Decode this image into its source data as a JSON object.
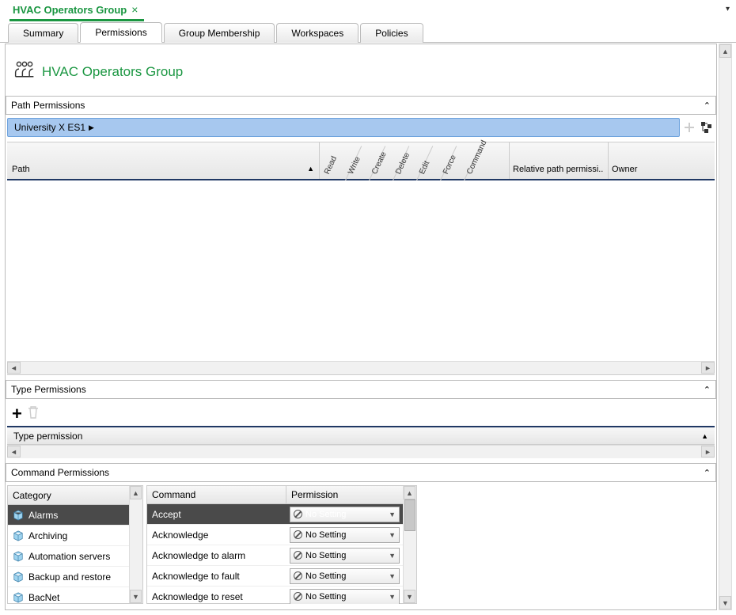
{
  "doc_tab": {
    "title": "HVAC Operators Group"
  },
  "sub_tabs": [
    "Summary",
    "Permissions",
    "Group Membership",
    "Workspaces",
    "Policies"
  ],
  "active_sub_tab": 1,
  "page_title": "HVAC Operators Group",
  "sections": {
    "path": {
      "label": "Path Permissions"
    },
    "type": {
      "label": "Type Permissions"
    },
    "command": {
      "label": "Command Permissions"
    }
  },
  "path_chip": "University X ES1",
  "path_columns": {
    "path": "Path",
    "diagonal": [
      "Read",
      "Write",
      "Create",
      "Delete",
      "Edit",
      "Force",
      "Command"
    ],
    "relative": "Relative path permissi..",
    "owner": "Owner"
  },
  "type_column": "Type permission",
  "categories": {
    "header": "Category",
    "items": [
      "Alarms",
      "Archiving",
      "Automation servers",
      "Backup and restore",
      "BacNet"
    ],
    "selected": 0
  },
  "commands": {
    "headers": {
      "command": "Command",
      "permission": "Permission"
    },
    "rows": [
      {
        "name": "Accept",
        "perm": "No Setting",
        "selected": true
      },
      {
        "name": "Acknowledge",
        "perm": "No Setting"
      },
      {
        "name": "Acknowledge to alarm",
        "perm": "No Setting"
      },
      {
        "name": "Acknowledge to fault",
        "perm": "No Setting"
      },
      {
        "name": "Acknowledge to reset",
        "perm": "No Setting"
      }
    ]
  }
}
